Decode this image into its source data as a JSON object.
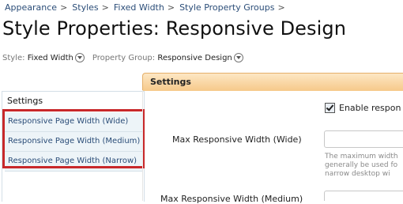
{
  "breadcrumb": {
    "items": [
      "Appearance",
      "Styles",
      "Fixed Width",
      "Style Property Groups"
    ],
    "separator": ">"
  },
  "page": {
    "title": "Style Properties: Responsive Design"
  },
  "filters": {
    "style_label": "Style:",
    "style_value": "Fixed Width",
    "group_label": "Property Group:",
    "group_value": "Responsive Design"
  },
  "tab": {
    "label": "Settings"
  },
  "sidebar": {
    "heading": "Settings",
    "items": [
      {
        "label": "Responsive Page Width (Wide)"
      },
      {
        "label": "Responsive Page Width (Medium)"
      },
      {
        "label": "Responsive Page Width (Narrow)"
      }
    ]
  },
  "form": {
    "checkbox_label": "Enable respon",
    "checkbox_checked": true,
    "field1_label": "Max Responsive Width (Wide)",
    "field1_help": [
      "The maximum width",
      "generally be used fo",
      "narrow desktop wi"
    ],
    "field2_label": "Max Responsive Width (Medium)"
  },
  "colors": {
    "link": "#2b4d78",
    "tab_gradient_top": "#fde7c4",
    "tab_gradient_bottom": "#f6c98a",
    "highlight_box": "#c8282a",
    "sidebar_item_bg": "#edf4f8"
  }
}
